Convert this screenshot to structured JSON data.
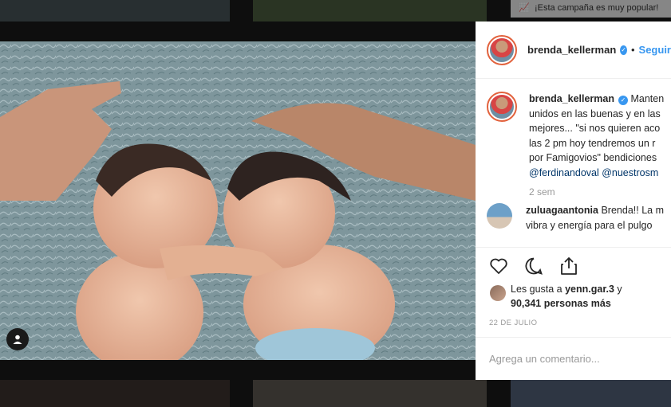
{
  "background": {
    "promo_text": "¡Esta campaña es muy popular!",
    "promo_icon": "trending-up-icon"
  },
  "post": {
    "image_alt": "Two newborn babies lying head to head on a blue fluffy blanket, with adult hands resting on them",
    "user_tag_icon": "user-tag-icon"
  },
  "header": {
    "username": "brenda_kellerman",
    "verified_icon": "verified-badge-icon",
    "separator": "•",
    "follow_label": "Seguir"
  },
  "caption": {
    "username": "brenda_kellerman",
    "lines": [
      "Manten",
      "unidos en las buenas y en las",
      "mejores... \"si nos quieren aco",
      "las 2 pm hoy tendremos un r",
      "por Famigovios\" bendiciones"
    ],
    "mentions": "@ferdinandoval @nuestrosm",
    "time": "2 sem"
  },
  "comment": {
    "username": "zuluagaantonia",
    "line1": "Brenda!! La m",
    "line2": "vibra y energía para el pulgo"
  },
  "actions": {
    "like_icon": "heart-icon",
    "comment_icon": "comment-icon",
    "share_icon": "share-icon"
  },
  "likes": {
    "prefix": "Les gusta a ",
    "user": "yenn.gar.3",
    "connector": " y",
    "count": "90,341 personas más"
  },
  "date": "22 DE JULIO",
  "add_comment": {
    "placeholder": "Agrega un comentario..."
  }
}
